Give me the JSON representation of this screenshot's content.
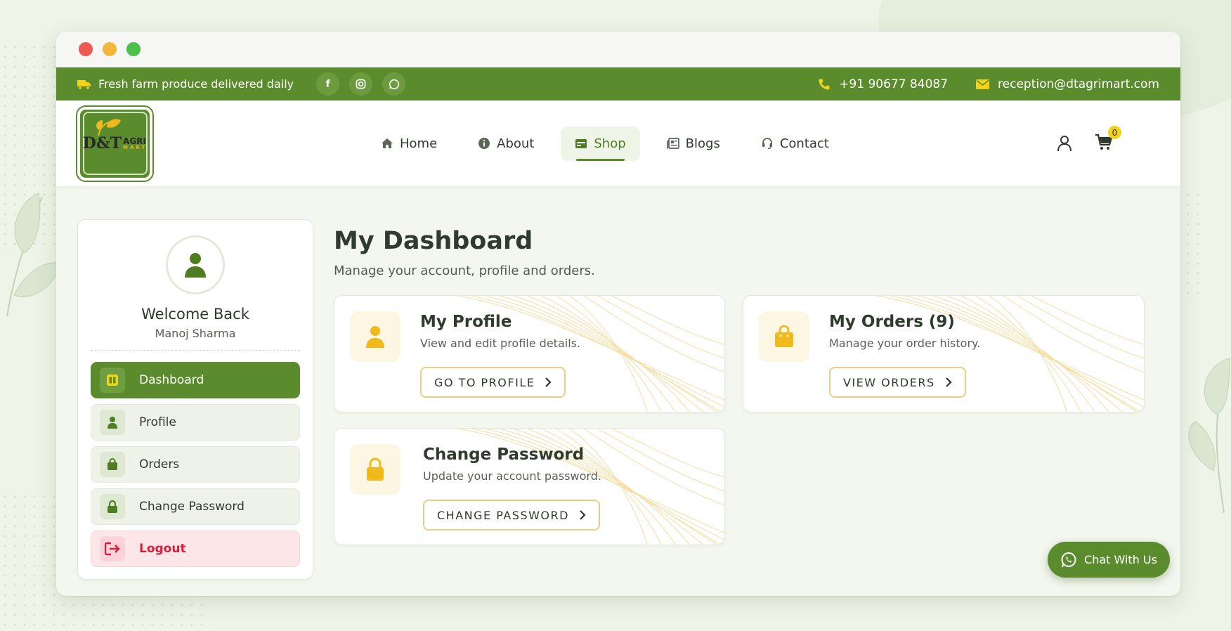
{
  "colors": {
    "primary": "#5a8b2c",
    "accent": "#f0b91c",
    "danger": "#d61f3a"
  },
  "topbar": {
    "tagline": "Fresh farm produce delivered daily",
    "socials": [
      "facebook-icon",
      "instagram-icon",
      "whatsapp-icon"
    ],
    "phone": "+91 90677 84087",
    "email": "reception@dtagrimart.com"
  },
  "logo": {
    "text": "D&T",
    "sub": "AGRI",
    "sub2": "MART"
  },
  "nav": [
    {
      "label": "Home",
      "icon": "home-icon"
    },
    {
      "label": "About",
      "icon": "info-icon"
    },
    {
      "label": "Shop",
      "icon": "shop-icon",
      "active": true
    },
    {
      "label": "Blogs",
      "icon": "newspaper-icon"
    },
    {
      "label": "Contact",
      "icon": "headset-icon"
    }
  ],
  "cart": {
    "count": "0"
  },
  "sidebar": {
    "welcome": "Welcome Back",
    "user_name": "Manoj Sharma",
    "items": [
      {
        "label": "Dashboard",
        "icon": "dashboard-icon",
        "active": true
      },
      {
        "label": "Profile",
        "icon": "user-icon"
      },
      {
        "label": "Orders",
        "icon": "bag-icon"
      },
      {
        "label": "Change Password",
        "icon": "lock-icon"
      },
      {
        "label": "Logout",
        "icon": "logout-icon"
      }
    ]
  },
  "main": {
    "title": "My Dashboard",
    "subtitle": "Manage your account, profile and orders.",
    "cards": [
      {
        "title": "My Profile",
        "desc": "View and edit profile details.",
        "button": "GO TO PROFILE",
        "icon": "user-icon"
      },
      {
        "title": "My Orders (9)",
        "desc": "Manage your order history.",
        "button": "VIEW ORDERS",
        "icon": "bag-icon"
      },
      {
        "title": "Change Password",
        "desc": "Update your account password.",
        "button": "CHANGE PASSWORD",
        "icon": "lock-icon"
      }
    ]
  },
  "chat": {
    "label": "Chat With Us"
  }
}
